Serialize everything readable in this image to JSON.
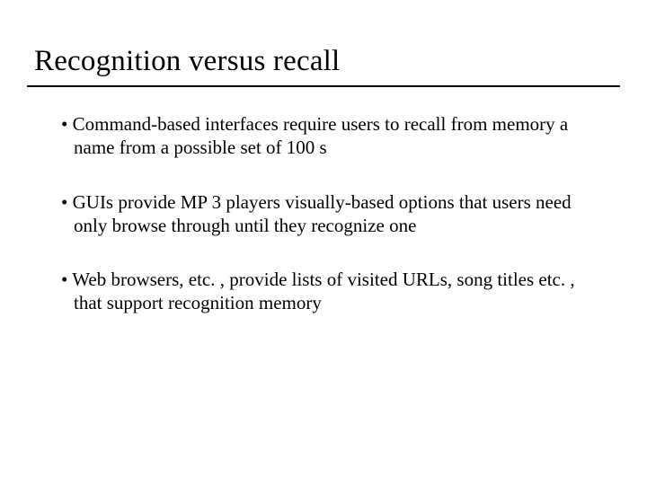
{
  "slide": {
    "title": "Recognition versus recall",
    "bullets": [
      {
        "text": "Command-based interfaces require users to recall from memory a name from a possible set of 100 s"
      },
      {
        "text": "GUIs provide MP 3 players visually-based options that users need only browse through until they recognize one"
      },
      {
        "text": "Web browsers, etc. , provide lists of visited URLs, song titles etc. , that support recognition memory"
      }
    ]
  }
}
